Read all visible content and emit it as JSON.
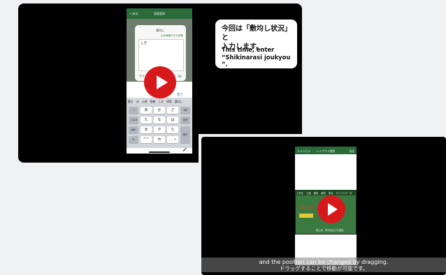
{
  "video1": {
    "phone": {
      "header": {
        "back": "≺ 戻る",
        "title": "状態登録"
      },
      "dialog": {
        "title": "敷均し",
        "subtitle": "土木用語からも可能",
        "input_value": "しき",
        "cancel_label": "キャンセル",
        "ok_label": "OK"
      },
      "done_label": "完了",
      "candidates": [
        "敷き",
        "式",
        "土地",
        "指揮",
        "しき",
        "四季",
        "敷均し"
      ],
      "keyboard": {
        "rows": [
          [
            "あ",
            "か",
            "さ"
          ],
          [
            "た",
            "な",
            "は"
          ],
          [
            "ま",
            "や",
            "ら"
          ],
          [
            "^^",
            "わ",
            "、。?!"
          ]
        ],
        "left_keys": [
          "→",
          "☆123",
          "ABC",
          "☺"
        ],
        "right_keys": [
          "⌫",
          "空白",
          "改行"
        ],
        "mic": "🎤"
      }
    },
    "bubble": {
      "jp_line1": "今回は「敷均し状況」と",
      "jp_line2": "入力します。",
      "en_line1": "This time, enter",
      "en_line2": "“Shikinarasi joukyou ”."
    }
  },
  "video2": {
    "phone": {
      "header": {
        "left": "キャンセル",
        "center": "レイアウト選択",
        "right": "決定"
      },
      "form_row": [
        "工事名",
        "工種",
        "種別",
        "細別",
        "測点",
        "サンプルデータ"
      ],
      "red_text": "敷均し状況",
      "footer": "施工者　株式会社〇〇建設"
    },
    "subtitle_en": "and the position can be changed by dragging.",
    "subtitle_jp": "ドラッグすることで移動が可能です。"
  },
  "colors": {
    "accent_green": "#2a6b3a",
    "play_red": "#d8191c"
  },
  "icons": {
    "play": "play-icon",
    "backspace": "backspace-icon",
    "mic": "mic-icon"
  }
}
